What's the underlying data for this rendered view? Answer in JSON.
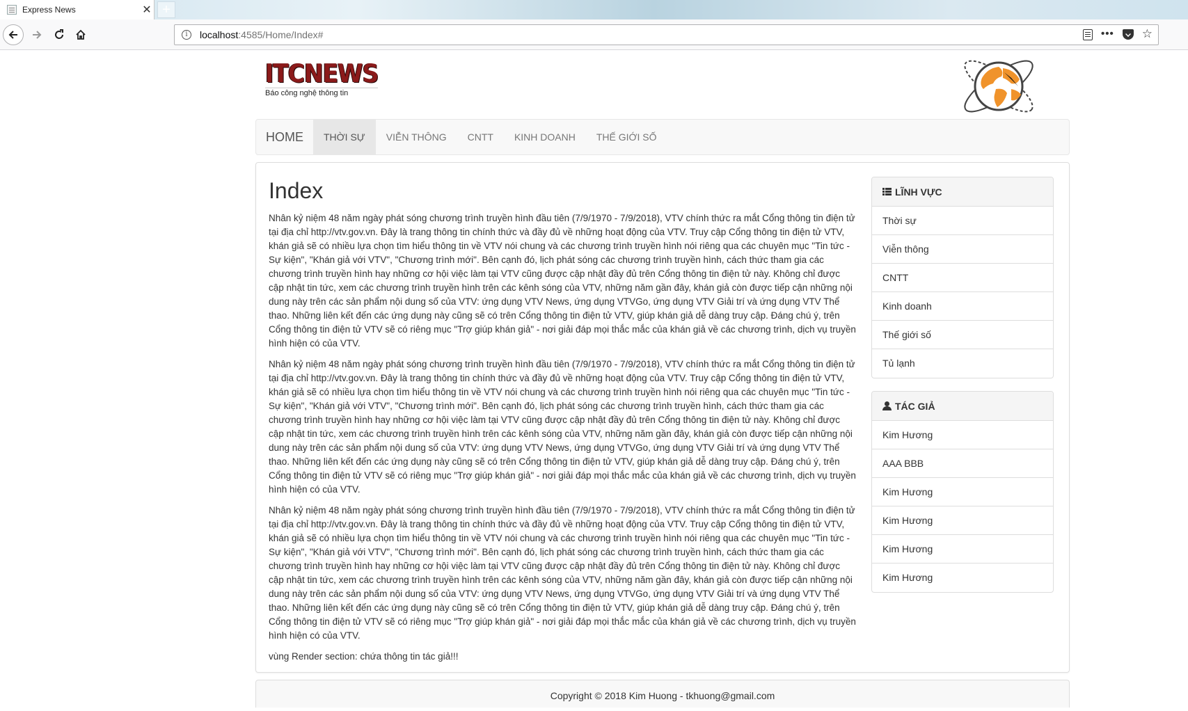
{
  "browser": {
    "tab_title": "Express News",
    "tab_close": "✕",
    "new_tab": "+",
    "url_host": "localhost",
    "url_path": ":4585/Home/Index#",
    "info_glyph": "i"
  },
  "header": {
    "logo": "ITCNEWS",
    "slogan": "Báo công nghệ thông tin"
  },
  "topnav": {
    "home": "HOME",
    "items": [
      "THỜI SỰ",
      "VIỄN THÔNG",
      "CNTT",
      "KINH DOANH",
      "THẾ GIỚI SỐ"
    ],
    "active_index": 0
  },
  "main": {
    "title": "Index",
    "paragraphs": [
      "Nhân kỷ niệm 48 năm ngày phát sóng chương trình truyền hình đầu tiên (7/9/1970 - 7/9/2018), VTV chính thức ra mắt Cổng thông tin điện tử tại địa chỉ http://vtv.gov.vn. Đây là trang thông tin chính thức và đầy đủ về những hoạt động của VTV. Truy cập Cổng thông tin điện tử VTV, khán giả sẽ có nhiều lựa chọn tìm hiểu thông tin về VTV nói chung và các chương trình truyền hình nói riêng qua các chuyên mục \"Tin tức - Sự kiện\", \"Khán giả với VTV\", \"Chương trình mới\". Bên cạnh đó, lịch phát sóng các chương trình truyền hình, cách thức tham gia các chương trình truyền hình hay những cơ hội việc làm tại VTV cũng được cập nhật đầy đủ trên Cổng thông tin điện tử này. Không chỉ được cập nhật tin tức, xem các chương trình truyền hình trên các kênh sóng của VTV, những năm gần đây, khán giả còn được tiếp cận những nội dung này trên các sản phẩm nội dung số của VTV: ứng dụng VTV News, ứng dụng VTVGo, ứng dụng VTV Giải trí và ứng dụng VTV Thể thao. Những liên kết đến các ứng dụng này cũng sẽ có trên Cổng thông tin điện tử VTV, giúp khán giả dễ dàng truy cập. Đáng chú ý, trên Cổng thông tin điện tử VTV sẽ có riêng mục \"Trợ giúp khán giả\" - nơi giải đáp mọi thắc mắc của khán giả về các chương trình, dịch vụ truyền hình hiện có của VTV.",
      "Nhân kỷ niệm 48 năm ngày phát sóng chương trình truyền hình đầu tiên (7/9/1970 - 7/9/2018), VTV chính thức ra mắt Cổng thông tin điện tử tại địa chỉ http://vtv.gov.vn. Đây là trang thông tin chính thức và đầy đủ về những hoạt động của VTV. Truy cập Cổng thông tin điện tử VTV, khán giả sẽ có nhiều lựa chọn tìm hiểu thông tin về VTV nói chung và các chương trình truyền hình nói riêng qua các chuyên mục \"Tin tức - Sự kiện\", \"Khán giả với VTV\", \"Chương trình mới\". Bên cạnh đó, lịch phát sóng các chương trình truyền hình, cách thức tham gia các chương trình truyền hình hay những cơ hội việc làm tại VTV cũng được cập nhật đầy đủ trên Cổng thông tin điện tử này. Không chỉ được cập nhật tin tức, xem các chương trình truyền hình trên các kênh sóng của VTV, những năm gần đây, khán giả còn được tiếp cận những nội dung này trên các sản phẩm nội dung số của VTV: ứng dụng VTV News, ứng dụng VTVGo, ứng dụng VTV Giải trí và ứng dụng VTV Thể thao. Những liên kết đến các ứng dụng này cũng sẽ có trên Cổng thông tin điện tử VTV, giúp khán giả dễ dàng truy cập. Đáng chú ý, trên Cổng thông tin điện tử VTV sẽ có riêng mục \"Trợ giúp khán giả\" - nơi giải đáp mọi thắc mắc của khán giả về các chương trình, dịch vụ truyền hình hiện có của VTV.",
      "Nhân kỷ niệm 48 năm ngày phát sóng chương trình truyền hình đầu tiên (7/9/1970 - 7/9/2018), VTV chính thức ra mắt Cổng thông tin điện tử tại địa chỉ http://vtv.gov.vn. Đây là trang thông tin chính thức và đầy đủ về những hoạt động của VTV. Truy cập Cổng thông tin điện tử VTV, khán giả sẽ có nhiều lựa chọn tìm hiểu thông tin về VTV nói chung và các chương trình truyền hình nói riêng qua các chuyên mục \"Tin tức - Sự kiện\", \"Khán giả với VTV\", \"Chương trình mới\". Bên cạnh đó, lịch phát sóng các chương trình truyền hình, cách thức tham gia các chương trình truyền hình hay những cơ hội việc làm tại VTV cũng được cập nhật đầy đủ trên Cổng thông tin điện tử này. Không chỉ được cập nhật tin tức, xem các chương trình truyền hình trên các kênh sóng của VTV, những năm gần đây, khán giả còn được tiếp cận những nội dung này trên các sản phẩm nội dung số của VTV: ứng dụng VTV News, ứng dụng VTVGo, ứng dụng VTV Giải trí và ứng dụng VTV Thể thao. Những liên kết đến các ứng dụng này cũng sẽ có trên Cổng thông tin điện tử VTV, giúp khán giả dễ dàng truy cập. Đáng chú ý, trên Cổng thông tin điện tử VTV sẽ có riêng mục \"Trợ giúp khán giả\" - nơi giải đáp mọi thắc mắc của khán giả về các chương trình, dịch vụ truyền hình hiện có của VTV."
    ],
    "render_section": "vùng Render section: chứa thông tin tác giả!!!"
  },
  "sidebar": {
    "categories": {
      "heading": "LĨNH VỰC",
      "items": [
        "Thời sự",
        "Viễn thông",
        "CNTT",
        "Kinh doanh",
        "Thế giới số",
        "Tủ lạnh"
      ]
    },
    "authors": {
      "heading": "TÁC GIẢ",
      "items": [
        "Kim Hương",
        "AAA BBB",
        "Kim Hương",
        "Kim Hương",
        "Kim Hương",
        "Kim Hương"
      ]
    }
  },
  "footer": {
    "text": "Copyright © 2018 Kim Huong - tkhuong@gmail.com"
  },
  "colors": {
    "logo": "#8b1a1a",
    "globe_orange": "#f0932b",
    "nav_active_bg": "#e7e7e7"
  }
}
